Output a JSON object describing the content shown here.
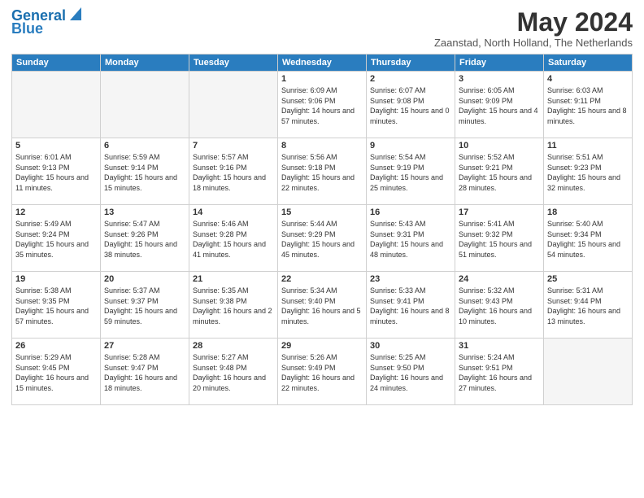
{
  "header": {
    "logo_line1": "General",
    "logo_line2": "Blue",
    "month_title": "May 2024",
    "location": "Zaanstad, North Holland, The Netherlands"
  },
  "days_of_week": [
    "Sunday",
    "Monday",
    "Tuesday",
    "Wednesday",
    "Thursday",
    "Friday",
    "Saturday"
  ],
  "weeks": [
    [
      {
        "day": "",
        "sunrise": "",
        "sunset": "",
        "daylight": ""
      },
      {
        "day": "",
        "sunrise": "",
        "sunset": "",
        "daylight": ""
      },
      {
        "day": "",
        "sunrise": "",
        "sunset": "",
        "daylight": ""
      },
      {
        "day": "1",
        "sunrise": "Sunrise: 6:09 AM",
        "sunset": "Sunset: 9:06 PM",
        "daylight": "Daylight: 14 hours and 57 minutes."
      },
      {
        "day": "2",
        "sunrise": "Sunrise: 6:07 AM",
        "sunset": "Sunset: 9:08 PM",
        "daylight": "Daylight: 15 hours and 0 minutes."
      },
      {
        "day": "3",
        "sunrise": "Sunrise: 6:05 AM",
        "sunset": "Sunset: 9:09 PM",
        "daylight": "Daylight: 15 hours and 4 minutes."
      },
      {
        "day": "4",
        "sunrise": "Sunrise: 6:03 AM",
        "sunset": "Sunset: 9:11 PM",
        "daylight": "Daylight: 15 hours and 8 minutes."
      }
    ],
    [
      {
        "day": "5",
        "sunrise": "Sunrise: 6:01 AM",
        "sunset": "Sunset: 9:13 PM",
        "daylight": "Daylight: 15 hours and 11 minutes."
      },
      {
        "day": "6",
        "sunrise": "Sunrise: 5:59 AM",
        "sunset": "Sunset: 9:14 PM",
        "daylight": "Daylight: 15 hours and 15 minutes."
      },
      {
        "day": "7",
        "sunrise": "Sunrise: 5:57 AM",
        "sunset": "Sunset: 9:16 PM",
        "daylight": "Daylight: 15 hours and 18 minutes."
      },
      {
        "day": "8",
        "sunrise": "Sunrise: 5:56 AM",
        "sunset": "Sunset: 9:18 PM",
        "daylight": "Daylight: 15 hours and 22 minutes."
      },
      {
        "day": "9",
        "sunrise": "Sunrise: 5:54 AM",
        "sunset": "Sunset: 9:19 PM",
        "daylight": "Daylight: 15 hours and 25 minutes."
      },
      {
        "day": "10",
        "sunrise": "Sunrise: 5:52 AM",
        "sunset": "Sunset: 9:21 PM",
        "daylight": "Daylight: 15 hours and 28 minutes."
      },
      {
        "day": "11",
        "sunrise": "Sunrise: 5:51 AM",
        "sunset": "Sunset: 9:23 PM",
        "daylight": "Daylight: 15 hours and 32 minutes."
      }
    ],
    [
      {
        "day": "12",
        "sunrise": "Sunrise: 5:49 AM",
        "sunset": "Sunset: 9:24 PM",
        "daylight": "Daylight: 15 hours and 35 minutes."
      },
      {
        "day": "13",
        "sunrise": "Sunrise: 5:47 AM",
        "sunset": "Sunset: 9:26 PM",
        "daylight": "Daylight: 15 hours and 38 minutes."
      },
      {
        "day": "14",
        "sunrise": "Sunrise: 5:46 AM",
        "sunset": "Sunset: 9:28 PM",
        "daylight": "Daylight: 15 hours and 41 minutes."
      },
      {
        "day": "15",
        "sunrise": "Sunrise: 5:44 AM",
        "sunset": "Sunset: 9:29 PM",
        "daylight": "Daylight: 15 hours and 45 minutes."
      },
      {
        "day": "16",
        "sunrise": "Sunrise: 5:43 AM",
        "sunset": "Sunset: 9:31 PM",
        "daylight": "Daylight: 15 hours and 48 minutes."
      },
      {
        "day": "17",
        "sunrise": "Sunrise: 5:41 AM",
        "sunset": "Sunset: 9:32 PM",
        "daylight": "Daylight: 15 hours and 51 minutes."
      },
      {
        "day": "18",
        "sunrise": "Sunrise: 5:40 AM",
        "sunset": "Sunset: 9:34 PM",
        "daylight": "Daylight: 15 hours and 54 minutes."
      }
    ],
    [
      {
        "day": "19",
        "sunrise": "Sunrise: 5:38 AM",
        "sunset": "Sunset: 9:35 PM",
        "daylight": "Daylight: 15 hours and 57 minutes."
      },
      {
        "day": "20",
        "sunrise": "Sunrise: 5:37 AM",
        "sunset": "Sunset: 9:37 PM",
        "daylight": "Daylight: 15 hours and 59 minutes."
      },
      {
        "day": "21",
        "sunrise": "Sunrise: 5:35 AM",
        "sunset": "Sunset: 9:38 PM",
        "daylight": "Daylight: 16 hours and 2 minutes."
      },
      {
        "day": "22",
        "sunrise": "Sunrise: 5:34 AM",
        "sunset": "Sunset: 9:40 PM",
        "daylight": "Daylight: 16 hours and 5 minutes."
      },
      {
        "day": "23",
        "sunrise": "Sunrise: 5:33 AM",
        "sunset": "Sunset: 9:41 PM",
        "daylight": "Daylight: 16 hours and 8 minutes."
      },
      {
        "day": "24",
        "sunrise": "Sunrise: 5:32 AM",
        "sunset": "Sunset: 9:43 PM",
        "daylight": "Daylight: 16 hours and 10 minutes."
      },
      {
        "day": "25",
        "sunrise": "Sunrise: 5:31 AM",
        "sunset": "Sunset: 9:44 PM",
        "daylight": "Daylight: 16 hours and 13 minutes."
      }
    ],
    [
      {
        "day": "26",
        "sunrise": "Sunrise: 5:29 AM",
        "sunset": "Sunset: 9:45 PM",
        "daylight": "Daylight: 16 hours and 15 minutes."
      },
      {
        "day": "27",
        "sunrise": "Sunrise: 5:28 AM",
        "sunset": "Sunset: 9:47 PM",
        "daylight": "Daylight: 16 hours and 18 minutes."
      },
      {
        "day": "28",
        "sunrise": "Sunrise: 5:27 AM",
        "sunset": "Sunset: 9:48 PM",
        "daylight": "Daylight: 16 hours and 20 minutes."
      },
      {
        "day": "29",
        "sunrise": "Sunrise: 5:26 AM",
        "sunset": "Sunset: 9:49 PM",
        "daylight": "Daylight: 16 hours and 22 minutes."
      },
      {
        "day": "30",
        "sunrise": "Sunrise: 5:25 AM",
        "sunset": "Sunset: 9:50 PM",
        "daylight": "Daylight: 16 hours and 24 minutes."
      },
      {
        "day": "31",
        "sunrise": "Sunrise: 5:24 AM",
        "sunset": "Sunset: 9:51 PM",
        "daylight": "Daylight: 16 hours and 27 minutes."
      },
      {
        "day": "",
        "sunrise": "",
        "sunset": "",
        "daylight": ""
      }
    ]
  ]
}
